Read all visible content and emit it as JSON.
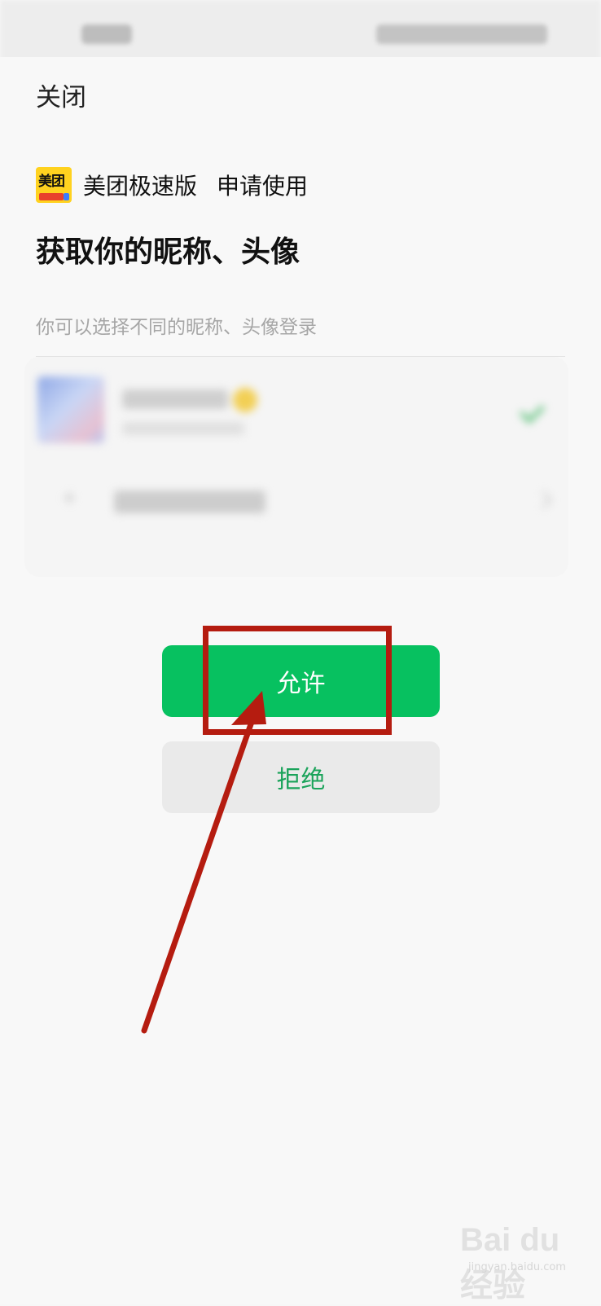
{
  "topbar": {
    "close_label": "关闭"
  },
  "app": {
    "logo_text": "美团",
    "name": "美团极速版",
    "request_label": "申请使用"
  },
  "permission": {
    "title": "获取你的昵称、头像",
    "description": "你可以选择不同的昵称、头像登录"
  },
  "actions": {
    "allow_label": "允许",
    "reject_label": "拒绝"
  },
  "watermark": {
    "main": "Bai du 经验",
    "sub": "jingyan.baidu.com"
  },
  "colors": {
    "allow_button": "#07c160",
    "reject_text": "#1aa35a",
    "annotation": "#b51c10",
    "logo_bg": "#ffd21f"
  },
  "icons": [
    "app-logo",
    "check-icon",
    "plus-icon",
    "chevron-right-icon",
    "annotation-arrow"
  ]
}
